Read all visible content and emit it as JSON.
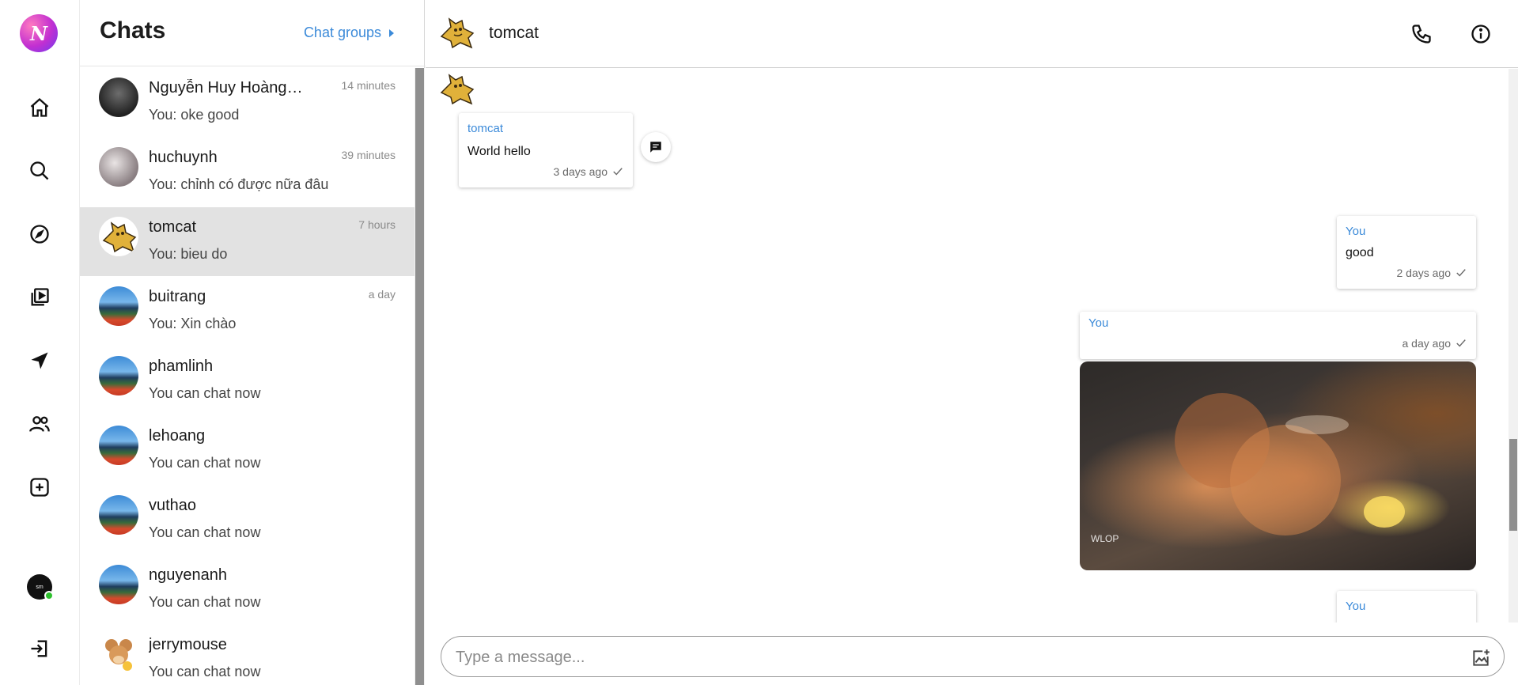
{
  "app": {
    "logo_letter": "N",
    "accent_color": "#3b8ad9"
  },
  "rail": {
    "items": [
      {
        "icon": "home-icon"
      },
      {
        "icon": "search-icon"
      },
      {
        "icon": "compass-icon"
      },
      {
        "icon": "video-library-icon"
      },
      {
        "icon": "send-icon"
      },
      {
        "icon": "people-icon"
      },
      {
        "icon": "add-box-icon"
      }
    ],
    "user_avatar_text": "sm",
    "logout_icon": "logout-icon"
  },
  "chat_list": {
    "title": "Chats",
    "groups_link": "Chat groups",
    "items": [
      {
        "name": "Nguyễn Huy Hoàng@tn…",
        "time": "14 minutes",
        "preview": "You: oke good",
        "avatar": "photo-1"
      },
      {
        "name": "huchuynh",
        "time": "39 minutes",
        "preview": "You: chỉnh có được nữa đâu",
        "avatar": "photo-2"
      },
      {
        "name": "tomcat",
        "time": "7 hours",
        "preview": "You: bieu do",
        "avatar": "tomcat",
        "active": true
      },
      {
        "name": "buitrang",
        "time": "a day",
        "preview": "You: Xin chào",
        "avatar": "stadium"
      },
      {
        "name": "phamlinh",
        "time": "",
        "preview": "You can chat now",
        "avatar": "stadium"
      },
      {
        "name": "lehoang",
        "time": "",
        "preview": "You can chat now",
        "avatar": "stadium"
      },
      {
        "name": "vuthao",
        "time": "",
        "preview": "You can chat now",
        "avatar": "stadium"
      },
      {
        "name": "nguyenanh",
        "time": "",
        "preview": "You can chat now",
        "avatar": "stadium"
      },
      {
        "name": "jerrymouse",
        "time": "",
        "preview": "You can chat now",
        "avatar": "jerry"
      }
    ]
  },
  "conversation": {
    "title": "tomcat",
    "messages": [
      {
        "sender": "tomcat",
        "text": "World hello",
        "time": "3 days ago"
      },
      {
        "sender": "You",
        "text": "good",
        "time": "2 days ago"
      },
      {
        "sender": "You",
        "text": "",
        "time": "a day ago",
        "attachment": "image"
      },
      {
        "sender": "You",
        "text": "",
        "time": ""
      }
    ],
    "image_watermark": "WLOP"
  },
  "composer": {
    "placeholder": "Type a message..."
  }
}
